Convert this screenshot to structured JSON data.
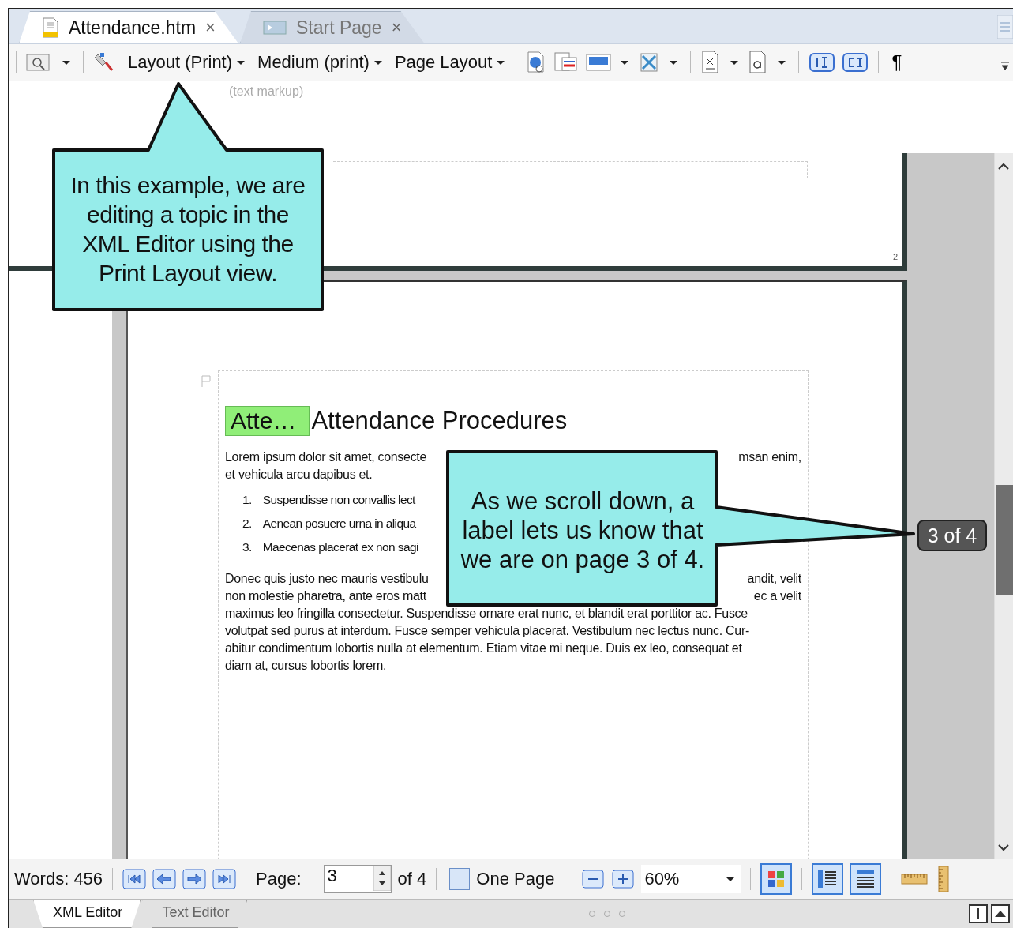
{
  "tabs": [
    {
      "label": "Attendance.htm",
      "close": "×",
      "selected": true
    },
    {
      "label": "Start Page",
      "close": "×",
      "selected": false
    }
  ],
  "toolbar": {
    "dropdowns": [
      "Layout (Print)",
      "Medium (print)",
      "Page Layout"
    ],
    "pilcrow": "¶"
  },
  "hint": "(text markup)",
  "previous_page_number": "2",
  "page": {
    "tag": "Atte…",
    "heading": "Attendance Procedures",
    "paragraph_1": [
      {
        "left": "Lorem ipsum dolor sit amet, consecte",
        "right": "msan enim,"
      },
      {
        "left": "et vehicula arcu dapibus et."
      }
    ],
    "list": [
      {
        "number": "1.",
        "text": "Suspendisse non convallis lect"
      },
      {
        "number": "2.",
        "text": "Aenean posuere urna in aliqua"
      },
      {
        "number": "3.",
        "text": "Maecenas placerat ex non sagi"
      }
    ],
    "paragraph_2": [
      {
        "left": "Donec quis justo nec mauris vestibulu",
        "right": "andit, velit"
      },
      {
        "left": "non molestie pharetra, ante eros matt",
        "right": "ec a velit"
      },
      {
        "left": "maximus leo fringilla consectetur. Suspendisse ornare erat nunc, et blandit erat porttitor ac. Fusce"
      },
      {
        "left": "volutpat sed purus at interdum. Fusce semper vehicula placerat. Vestibulum nec lectus nunc. Cur-"
      },
      {
        "left": "abitur condimentum lobortis nulla at elementum. Etiam vitae mi neque. Duis ex leo, consequat et"
      },
      {
        "left": "diam at, cursus lobortis lorem."
      }
    ]
  },
  "page_label": "3 of 4",
  "callouts": [
    "In this example, we are editing a topic in the XML Editor using the Print Layout view.",
    "As we scroll down, a label lets us know that we are on page 3 of 4."
  ],
  "status_bar": {
    "words": "Words: 456",
    "page_label": "Page:",
    "page_value": "3",
    "of_pages": "of 4",
    "one_page": "One Page",
    "one_page_checked": false,
    "zoom": "60%"
  },
  "editor_tabs": [
    {
      "label": "XML Editor",
      "selected": true
    },
    {
      "label": "Text Editor",
      "selected": false
    }
  ]
}
